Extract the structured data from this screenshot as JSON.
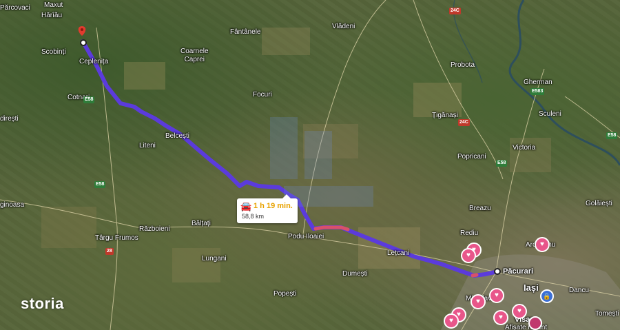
{
  "places": {
    "parcovaci": "Părcovaci",
    "maxut": "Maxut",
    "hariau": "Hărîău",
    "scobinti": "Scobinți",
    "ceplenita": "Ceplenița",
    "cotnari": "Cotnari",
    "diresti": "direști",
    "belcesti": "Belcești",
    "liteni": "Liteni",
    "fantanele": "Fântânele",
    "coarnele_caprei": "Coarnele\nCaprei",
    "focuri": "Focuri",
    "vladeni": "Vlădeni",
    "probota": "Probota",
    "gherman": "Gherman",
    "sculeni": "Sculeni",
    "tiganasi": "Țigănași",
    "victoria": "Victoria",
    "popricani": "Popricani",
    "breazu": "Breazu",
    "rediu": "Rediu",
    "golaiesti": "Golăiești",
    "aroneanu": "Aroneanu",
    "pacurari": "Păcurari",
    "iasi": "Iași",
    "dancu": "Dancu",
    "tomesti": "Tomești",
    "letcani": "Lețcani",
    "podu_iloaiei": "Podu Iloaiei",
    "baltati": "Bălțați",
    "razboieni": "Războieni",
    "targu_frumos": "Târgu Frumos",
    "lungani": "Lungani",
    "dumesti": "Dumești",
    "popesti": "Popești",
    "sinoasa": "ginoasa",
    "miroslava": "Miroslava",
    "visan": "Visan",
    "afisate_recent": "Afișate recent"
  },
  "roads": {
    "e58_a": "E58",
    "e58_b": "E58",
    "e58_c": "E58",
    "e58_d": "E58",
    "e583": "E583",
    "r24c_a": "24C",
    "r24c_b": "24C",
    "r28": "28",
    "r28b": "28"
  },
  "route": {
    "duration": "1 h 19 min.",
    "distance": "58,8 km",
    "color": "#5b3bdc",
    "traffic_color": "#d9506a"
  },
  "brand": {
    "logo": "storia"
  }
}
